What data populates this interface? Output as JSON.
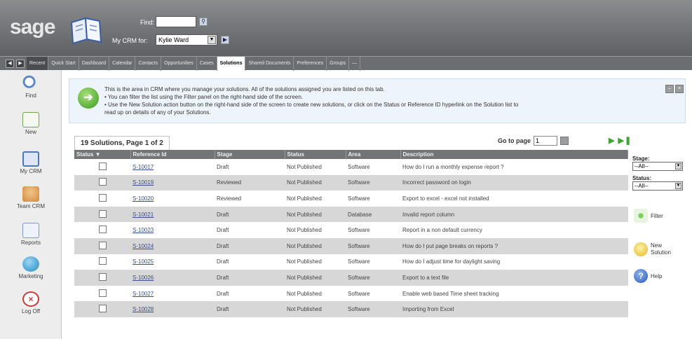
{
  "header": {
    "logo_text": "sage",
    "find_label": "Find:",
    "find_value": "",
    "crm_for_label": "My CRM for:",
    "crm_for_value": "Kylie Ward"
  },
  "tabbar": {
    "recent_label": "Recent",
    "tabs": [
      "Quick Start",
      "Dashboard",
      "Calendar",
      "Contacts",
      "Opportunities",
      "Cases",
      "Solutions",
      "Shared Documents",
      "Preferences",
      "Groups",
      "—"
    ],
    "active_tab": "Solutions"
  },
  "sidebar": {
    "items": [
      {
        "label": "Find",
        "icon": "magnifier-icon",
        "color": "#5b86c7"
      },
      {
        "label": "New",
        "icon": "new-document-icon",
        "color": "#6ca84a"
      },
      {
        "label": "My CRM",
        "icon": "book-icon",
        "color": "#4f77b8"
      },
      {
        "label": "Team CRM",
        "icon": "team-icon",
        "color": "#d28a3c"
      },
      {
        "label": "Reports",
        "icon": "reports-icon",
        "color": "#7d98c9"
      },
      {
        "label": "Marketing",
        "icon": "globe-icon",
        "color": "#4ea8d9"
      },
      {
        "label": "Log Off",
        "icon": "logoff-icon",
        "color": "#c43b3b"
      }
    ]
  },
  "info": {
    "line1": "This is the area in CRM where you manage your solutions. All of the solutions assigned you are listed on this tab.",
    "bullet1": "You can filter the list using the Filter panel on the right-hand side of the screen.",
    "bullet2": "Use the New Solution action button on the right-hand side of the screen to create new solutions, or click on the Status or Reference ID hyperlink on the Solution list to",
    "line_end": "read up on details of any of your Solutions."
  },
  "list": {
    "tab_label": "19 Solutions, Page 1 of 2",
    "goto_label": "Go to page",
    "goto_value": "1",
    "columns": [
      "Status ▼",
      "Reference Id",
      "Stage",
      "Status",
      "Area",
      "Description"
    ],
    "rows": [
      {
        "ref": "S-10017",
        "stage": "Draft",
        "status": "Not Published",
        "area": "Software",
        "desc": "How do I run a monthly expense report ?"
      },
      {
        "ref": "S-10019",
        "stage": "Reviewed",
        "status": "Not Published",
        "area": "Software",
        "desc": "Incorrect password on login"
      },
      {
        "ref": "S-10020",
        "stage": "Reviewed",
        "status": "Not Published",
        "area": "Software",
        "desc": "Export to excel - excel not installed"
      },
      {
        "ref": "S-10021",
        "stage": "Draft",
        "status": "Not Published",
        "area": "Database",
        "desc": "Invalid report column"
      },
      {
        "ref": "S-10023",
        "stage": "Draft",
        "status": "Not Published",
        "area": "Software",
        "desc": "Report in a non default currency"
      },
      {
        "ref": "S-10024",
        "stage": "Draft",
        "status": "Not Published",
        "area": "Software",
        "desc": "How do I put page breaks on reports ?"
      },
      {
        "ref": "S-10025",
        "stage": "Draft",
        "status": "Not Published",
        "area": "Software",
        "desc": "How do I adjust time for daylight saving"
      },
      {
        "ref": "S-10026",
        "stage": "Draft",
        "status": "Not Published",
        "area": "Software",
        "desc": "Export to a text file"
      },
      {
        "ref": "S-10027",
        "stage": "Draft",
        "status": "Not Published",
        "area": "Software",
        "desc": "Enable web based Time sheet tracking"
      },
      {
        "ref": "S-10028",
        "stage": "Draft",
        "status": "Not Published",
        "area": "Software",
        "desc": "Importing from Excel"
      }
    ]
  },
  "filter": {
    "stage_label": "Stage:",
    "stage_value": "--All--",
    "status_label": "Status:",
    "status_value": "--All--",
    "filter_button": "Filter",
    "new_solution_line1": "New",
    "new_solution_line2": "Solution",
    "help_label": "Help"
  }
}
